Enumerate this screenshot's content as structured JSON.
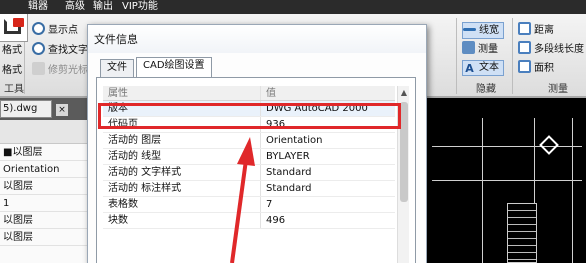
{
  "menubar": {
    "items": [
      "辑器",
      "高级",
      "输出",
      "VIP功能"
    ]
  },
  "ribbon": {
    "left_labels": [
      "式",
      "格式",
      "格式"
    ],
    "commands": [
      {
        "label": "显示点",
        "icon": "target-icon"
      },
      {
        "label": "查找文字",
        "icon": "search-text-icon"
      },
      {
        "label": "修剪光标",
        "icon": "trim-cursor-icon"
      }
    ],
    "tools_label": "工具",
    "right_commands": [
      {
        "label": "线宽",
        "icon": "lineweight-icon"
      },
      {
        "label": "测量",
        "icon": "measure-icon"
      },
      {
        "label": "文本",
        "icon": "text-icon"
      },
      {
        "label": "距离",
        "icon": "distance-icon"
      },
      {
        "label": "多段线长度",
        "icon": "polyline-length-icon"
      },
      {
        "label": "面积",
        "icon": "area-icon"
      }
    ],
    "group_hide_label": "隐藏",
    "group_measure_label": "测量"
  },
  "document_tab": {
    "label": "5).dwg",
    "close_label": "×"
  },
  "property_panel": {
    "rows": [
      "■以图层",
      "Orientation",
      "以图层",
      "1",
      "以图层",
      "以图层"
    ]
  },
  "dialog": {
    "title": "文件信息",
    "tabs": [
      "文件",
      "CAD绘图设置"
    ],
    "active_tab": 1,
    "table": {
      "headers": [
        "属性",
        "值"
      ],
      "rows": [
        {
          "key": "版本",
          "value": "DWG AutoCAD 2000"
        },
        {
          "key": "代码页",
          "value": "936"
        },
        {
          "key": "活动的 图层",
          "value": "Orientation"
        },
        {
          "key": "活动的 线型",
          "value": "BYLAYER"
        },
        {
          "key": "活动的 文字样式",
          "value": "Standard"
        },
        {
          "key": "活动的 标注样式",
          "value": "Standard"
        },
        {
          "key": "表格数",
          "value": "7"
        },
        {
          "key": "块数",
          "value": "496"
        }
      ]
    }
  },
  "colors": {
    "highlight_box": "#e0282a",
    "arrow": "#e0282a"
  }
}
